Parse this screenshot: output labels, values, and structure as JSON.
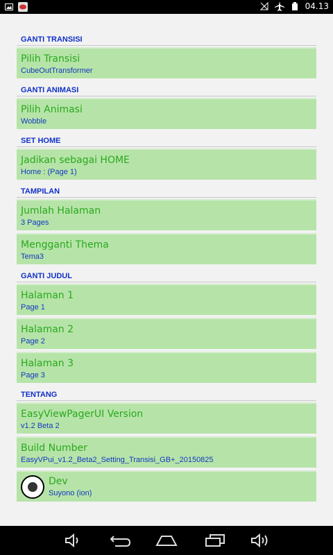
{
  "status": {
    "time": "04.13",
    "icons": [
      "picture-icon",
      "app-badge-icon",
      "no-signal-icon",
      "airplane-icon",
      "battery-icon"
    ]
  },
  "sections": [
    {
      "header": "GANTI TRANSISI",
      "items": [
        {
          "title": "Pilih Transisi",
          "sub": "CubeOutTransformer"
        }
      ]
    },
    {
      "header": "GANTI ANIMASI",
      "items": [
        {
          "title": "Pilih Animasi",
          "sub": "Wobble"
        }
      ]
    },
    {
      "header": "SET HOME",
      "items": [
        {
          "title": "Jadikan sebagai HOME",
          "sub": "Home : (Page 1)"
        }
      ]
    },
    {
      "header": "TAMPILAN",
      "items": [
        {
          "title": "Jumlah Halaman",
          "sub": "3 Pages"
        },
        {
          "title": "Mengganti Thema",
          "sub": "Tema3"
        }
      ]
    },
    {
      "header": "GANTI JUDUL",
      "items": [
        {
          "title": "Halaman 1",
          "sub": "Page 1"
        },
        {
          "title": "Halaman 2",
          "sub": "Page 2"
        },
        {
          "title": "Halaman 3",
          "sub": "Page 3"
        }
      ]
    },
    {
      "header": "TENTANG",
      "items": [
        {
          "title": "EasyViewPagerUI Version",
          "sub": "v1.2 Beta 2"
        },
        {
          "title": "Build Number",
          "sub": "EasyVPui_v1.2_Beta2_Setting_Transisi_GB+_20150825"
        },
        {
          "title": "Dev",
          "sub": "Suyono (ion)"
        }
      ]
    }
  ],
  "nav": [
    "volume-down-icon",
    "back-icon",
    "home-icon",
    "recents-icon",
    "volume-up-icon"
  ]
}
